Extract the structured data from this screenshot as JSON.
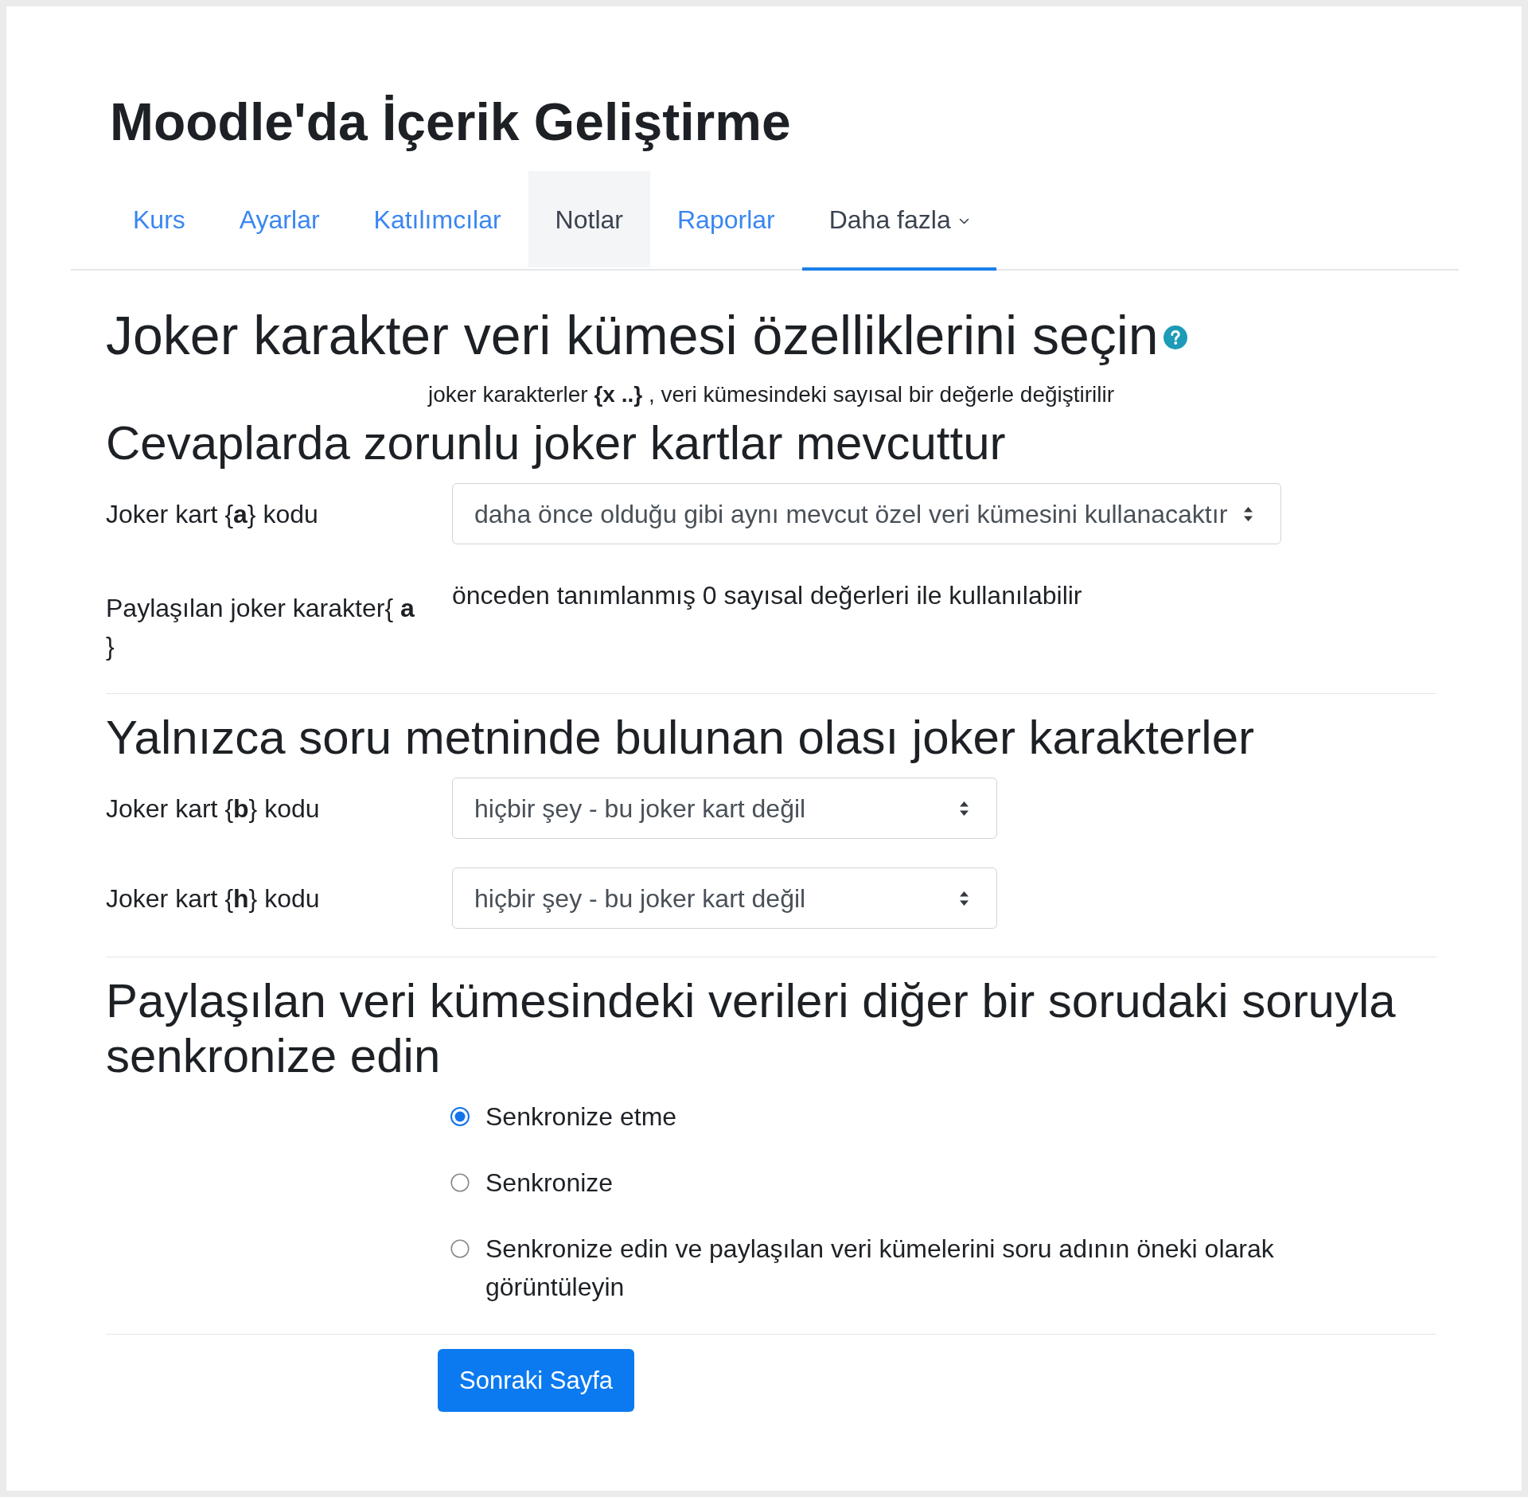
{
  "page_title": "Moodle'da İçerik Geliştirme",
  "tabs": [
    {
      "label": "Kurs",
      "kind": "link",
      "selected": false,
      "hovered": false
    },
    {
      "label": "Ayarlar",
      "kind": "link",
      "selected": false,
      "hovered": false
    },
    {
      "label": "Katılımcılar",
      "kind": "link",
      "selected": false,
      "hovered": false
    },
    {
      "label": "Notlar",
      "kind": "link",
      "selected": false,
      "hovered": true
    },
    {
      "label": "Raporlar",
      "kind": "link",
      "selected": false,
      "hovered": false
    },
    {
      "label": "Daha fazla",
      "kind": "dropdown",
      "selected": true,
      "hovered": false
    }
  ],
  "heading": "Joker karakter veri kümesi özelliklerini seçin",
  "description": "joker karakterler **{x ..}** , veri kümesindeki sayısal bir değerle değiştirilir",
  "sections": [
    {
      "heading": "Cevaplarda zorunlu joker kartlar mevcuttur",
      "fields": [
        {
          "kind": "select",
          "label": "Joker kart {**a**} kodu",
          "value": "daha önce olduğu gibi aynı mevcut özel veri kümesini kullanacaktır"
        },
        {
          "kind": "static",
          "label": "Paylaşılan joker karakter{ **a** }",
          "value": "önceden tanımlanmış 0 sayısal değerleri ile kullanılabilir"
        }
      ]
    },
    {
      "heading": "Yalnızca soru metninde bulunan olası joker karakterler",
      "fields": [
        {
          "kind": "select",
          "label": "Joker kart {**b**} kodu",
          "value": "hiçbir şey - bu joker kart değil"
        },
        {
          "kind": "select",
          "label": "Joker kart {**h**} kodu",
          "value": "hiçbir şey - bu joker kart değil"
        }
      ]
    },
    {
      "heading": "Paylaşılan veri kümesindeki verileri diğer bir sorudaki soruyla senkronize edin",
      "fields": [
        {
          "kind": "radio_group",
          "options": [
            {
              "label": "Senkronize etme",
              "selected": true
            },
            {
              "label": "Senkronize",
              "selected": false
            },
            {
              "label": "Senkronize edin ve paylaşılan veri kümelerini soru adının öneki olarak görüntüleyin",
              "selected": false
            }
          ]
        }
      ]
    }
  ],
  "submit_button": "Sonraki Sayfa"
}
